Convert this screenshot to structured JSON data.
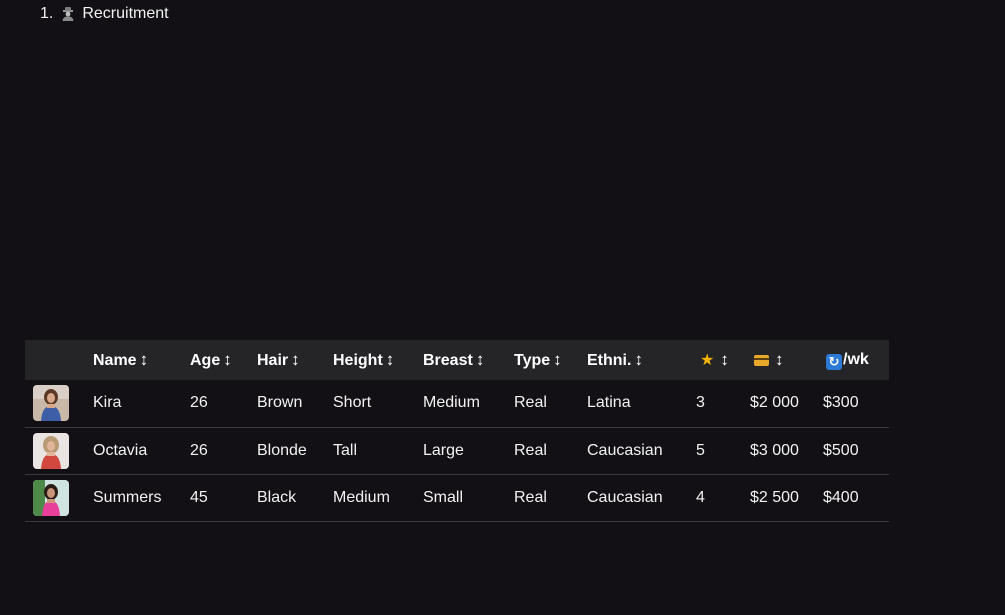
{
  "nav": {
    "number": "1.",
    "label": "Recruitment",
    "icon": "detective-icon"
  },
  "table": {
    "columns": [
      {
        "key": "photo",
        "label": ""
      },
      {
        "key": "name",
        "label": "Name",
        "sortable": true
      },
      {
        "key": "age",
        "label": "Age",
        "sortable": true
      },
      {
        "key": "hair",
        "label": "Hair",
        "sortable": true
      },
      {
        "key": "height",
        "label": "Height",
        "sortable": true
      },
      {
        "key": "breast",
        "label": "Breast",
        "sortable": true
      },
      {
        "key": "type",
        "label": "Type",
        "sortable": true
      },
      {
        "key": "ethnicity",
        "label": "Ethni.",
        "sortable": true
      },
      {
        "key": "rating",
        "label": "",
        "icon": "star-icon",
        "sortable": true
      },
      {
        "key": "cost",
        "label": "",
        "icon": "credit-card-icon",
        "sortable": true
      },
      {
        "key": "wage",
        "label": "/wk",
        "icon": "repeat-icon",
        "sortable": false
      }
    ],
    "sort_glyph": "↕",
    "star_glyph": "★",
    "repeat_glyph": "🔄",
    "rows": [
      {
        "name": "Kira",
        "age": "26",
        "hair": "Brown",
        "height": "Short",
        "breast": "Medium",
        "type": "Real",
        "ethnicity": "Latina",
        "rating": "3",
        "cost": "$2 000",
        "wage": "$300"
      },
      {
        "name": "Octavia",
        "age": "26",
        "hair": "Blonde",
        "height": "Tall",
        "breast": "Large",
        "type": "Real",
        "ethnicity": "Caucasian",
        "rating": "5",
        "cost": "$3 000",
        "wage": "$500"
      },
      {
        "name": "Summers",
        "age": "45",
        "hair": "Black",
        "height": "Medium",
        "breast": "Small",
        "type": "Real",
        "ethnicity": "Caucasian",
        "rating": "4",
        "cost": "$2 500",
        "wage": "$400"
      }
    ]
  },
  "colors": {
    "background": "#121014",
    "header_bg": "#252427",
    "row_border": "#3a393c",
    "text": "#f2f2f2",
    "star": "#f4b400",
    "card": "#e8a92a",
    "repeat": "#2b7bd6"
  }
}
